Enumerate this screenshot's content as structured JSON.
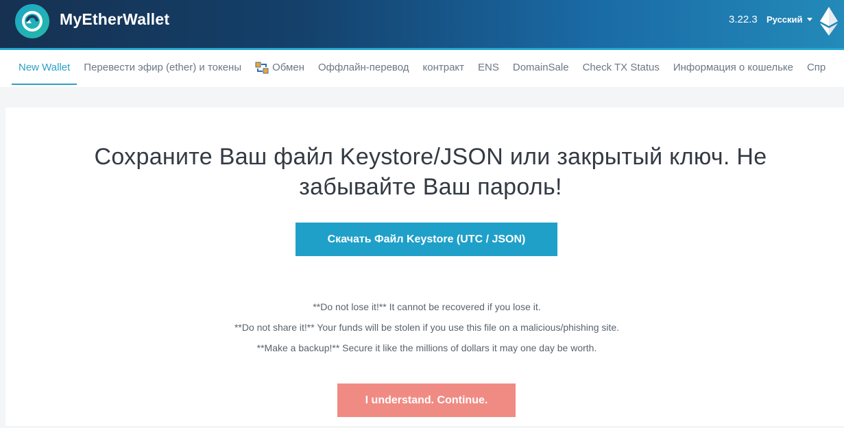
{
  "header": {
    "brand": "MyEtherWallet",
    "version": "3.22.3",
    "language": "Русский"
  },
  "nav": {
    "items": [
      {
        "label": "New Wallet",
        "active": true
      },
      {
        "label": "Перевести эфир (ether) и токены"
      },
      {
        "label": "Обмен",
        "icon": "swap-icon"
      },
      {
        "label": "Оффлайн-перевод"
      },
      {
        "label": "контракт"
      },
      {
        "label": "ENS"
      },
      {
        "label": "DomainSale"
      },
      {
        "label": "Check TX Status"
      },
      {
        "label": "Информация о кошельке"
      },
      {
        "label": "Спр"
      }
    ]
  },
  "main": {
    "title_line1": "Сохраните Ваш файл Keystore/JSON или закрытый ключ. Не",
    "title_line2": "забывайте Ваш пароль!",
    "download_button": "Скачать Файл Keystore (UTC / JSON)",
    "warnings": [
      "**Do not lose it!** It cannot be recovered if you lose it.",
      "**Do not share it!** Your funds will be stolen if you use this file on a malicious/phishing site.",
      "**Make a backup!** Secure it like the millions of dollars it may one day be worth."
    ],
    "continue_button": "I understand. Continue."
  },
  "colors": {
    "accent": "#1fa0c9",
    "continue": "#f08b84",
    "header_dark": "#163151"
  }
}
